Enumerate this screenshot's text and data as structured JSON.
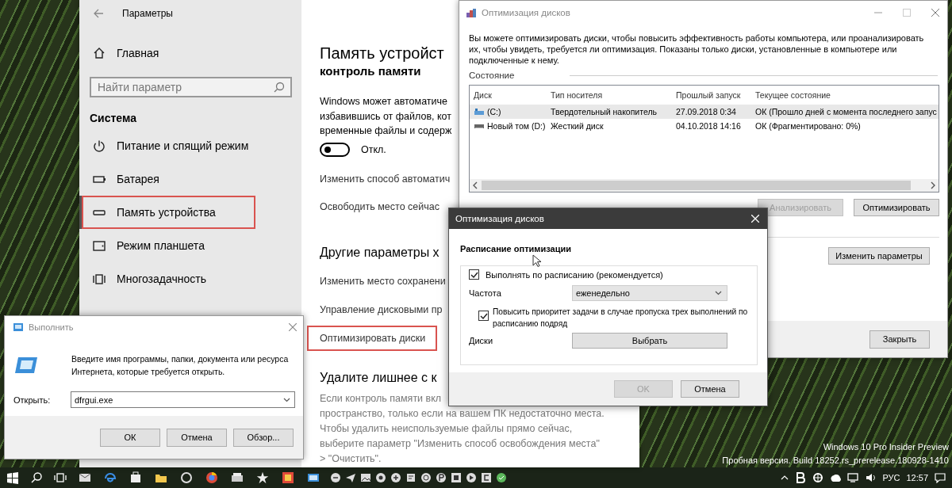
{
  "settings": {
    "title": "Параметры",
    "home": "Главная",
    "search": {
      "placeholder": "Найти параметр"
    },
    "section_title": "Система",
    "nav_items": [
      {
        "kind": "power",
        "label": "Питание и спящий режим",
        "selected": false,
        "highlighted": false
      },
      {
        "kind": "battery",
        "label": "Батарея",
        "selected": false,
        "highlighted": false
      },
      {
        "kind": "storage",
        "label": "Память устройства",
        "selected": true,
        "highlighted": true
      },
      {
        "kind": "tablet",
        "label": "Режим планшета",
        "selected": false,
        "highlighted": false
      },
      {
        "kind": "multitask",
        "label": "Многозадачность",
        "selected": false,
        "highlighted": false
      }
    ],
    "page_title": "Память устройст",
    "storage_sense": {
      "title": "контроль памяти",
      "description_lines": [
        "Windows может автоматиче",
        "избавившись от файлов, кот",
        "временные файлы и содерж"
      ],
      "toggle": {
        "on": false,
        "label": "Откл."
      },
      "links": [
        {
          "label": "Изменить способ автоматич",
          "highlighted": false
        },
        {
          "label": "Освободить место сейчас",
          "highlighted": false
        }
      ]
    },
    "more_settings": {
      "title": "Другие параметры х",
      "links": [
        {
          "label": "Изменить место сохранени",
          "highlighted": false
        },
        {
          "label": "Управление дисковыми пр",
          "highlighted": false
        },
        {
          "label": "Оптимизировать диски",
          "highlighted": true
        }
      ]
    },
    "cleanup": {
      "title": "Удалите лишнее с к",
      "lines": [
        "Если контроль памяти вкл",
        "пространство, только если на вашем ПК недостаточно места.",
        "Чтобы удалить неиспользуемые файлы прямо сейчас,",
        "выберите параметр \"Изменить способ освобождения места\"",
        "> \"Очистить\"."
      ]
    }
  },
  "optimize_window": {
    "title": "Оптимизация дисков",
    "description": "Вы можете оптимизировать диски, чтобы повысить эффективность работы компьютера, или проанализировать их, чтобы увидеть, требуется ли оптимизация. Показаны только диски, установленные в компьютере или подключенные к нему.",
    "status_label": "Состояние",
    "table": {
      "columns": [
        "Диск",
        "Тип носителя",
        "Прошлый запуск",
        "Текущее состояние"
      ],
      "rows": [
        {
          "kind": "ssd",
          "selected": true,
          "cells": [
            "(C:)",
            "Твердотельный накопитель",
            "27.09.2018 0:34",
            "ОК (Прошло дней с момента последнего запус"
          ]
        },
        {
          "kind": "hdd",
          "selected": false,
          "cells": [
            "Новый том (D:)",
            "Жесткий диск",
            "04.10.2018 14:16",
            "ОК (Фрагментировано: 0%)"
          ]
        }
      ]
    },
    "actions": [
      {
        "label": "Анализировать",
        "disabled": true
      },
      {
        "label": "Оптимизировать",
        "disabled": false
      }
    ],
    "change_settings_button": "Изменить параметры",
    "close_button": "Закрыть"
  },
  "schedule_dialog": {
    "title": "Оптимизация дисков",
    "heading": "Расписание оптимизации",
    "run_on_schedule": {
      "label": "Выполнять по расписанию (рекомендуется)",
      "checked": true
    },
    "frequency": {
      "label": "Частота",
      "value": "еженедельно"
    },
    "raise_priority": {
      "label": "Повысить приоритет задачи в случае пропуска трех выполнений по расписанию подряд",
      "checked": true
    },
    "drives": {
      "label": "Диски",
      "button": "Выбрать"
    },
    "buttons": [
      {
        "label": "OK",
        "disabled": true
      },
      {
        "label": "Отмена",
        "disabled": false
      }
    ]
  },
  "run_dialog": {
    "title": "Выполнить",
    "prompt": "Введите имя программы, папки, документа или ресурса Интернета, которые требуется открыть.",
    "open_label": "Открыть:",
    "command": "dfrgui.exe",
    "buttons": [
      "ОК",
      "Отмена",
      "Обзор..."
    ]
  },
  "build_info": {
    "lines": [
      "Windows 10 Pro Insider Preview",
      "Пробная версия. Build 18252.rs_prerelease.180928-1410"
    ]
  },
  "taskbar": {
    "language": "РУС",
    "time": "12:57"
  }
}
